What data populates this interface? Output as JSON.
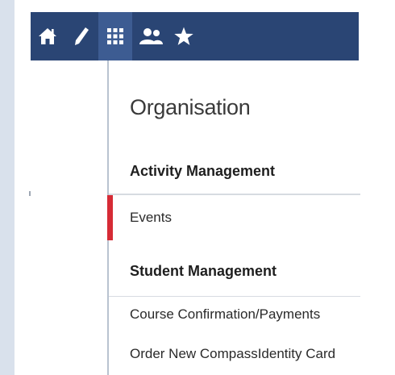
{
  "colors": {
    "navbar": "#2a4574",
    "navbar_active": "#3d5c92",
    "selection_marker": "#d62b35",
    "text": "#2a2a2a"
  },
  "navbar": {
    "items": [
      {
        "icon": "home-icon"
      },
      {
        "icon": "pencil-icon"
      },
      {
        "icon": "grid-icon",
        "active": true
      },
      {
        "icon": "people-icon"
      },
      {
        "icon": "star-icon"
      }
    ]
  },
  "menu": {
    "title": "Organisation",
    "sections": [
      {
        "heading": "Activity Management",
        "items": [
          {
            "label": "Events",
            "selected": true
          }
        ]
      },
      {
        "heading": "Student Management",
        "items": [
          {
            "label": "Course Confirmation/Payments"
          },
          {
            "label": "Order New CompassIdentity Card"
          }
        ]
      }
    ]
  }
}
